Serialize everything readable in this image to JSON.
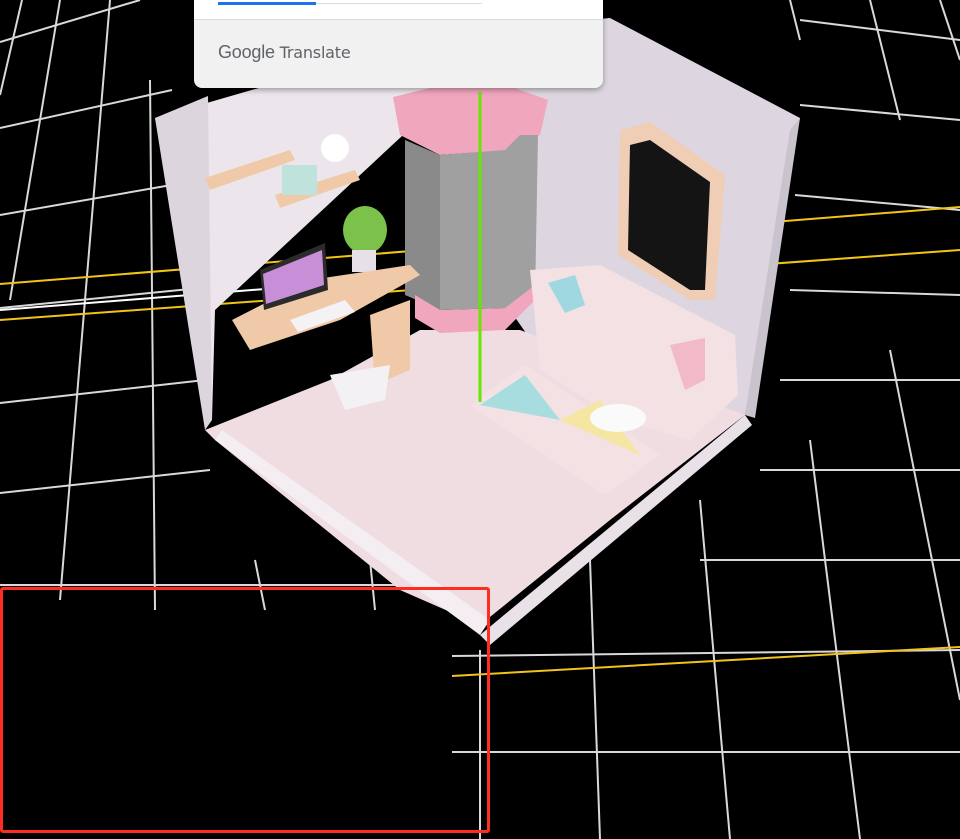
{
  "viewport": {
    "background": "#000000",
    "grid_color": "#d9d9d9",
    "axis_colors": {
      "x": "#f0c419",
      "y": "#66e600",
      "horizon": "#ffffff"
    }
  },
  "translate_popup": {
    "brand_google": "Google",
    "brand_product": "Translate",
    "progress": 0.37
  },
  "room_model": {
    "wall_color": "#f0e9ef",
    "floor_color": "#efdde2",
    "accent_pink": "#f0a6bd"
  },
  "selection": {
    "color": "#ff2d1f"
  }
}
